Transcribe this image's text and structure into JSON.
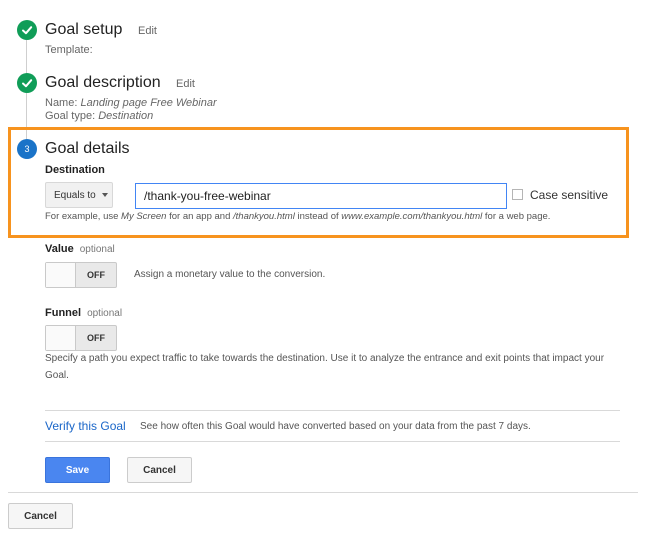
{
  "steps": [
    {
      "number": "1",
      "title": "Goal setup",
      "edit_label": "Edit",
      "details": {
        "template_label": "Template:"
      }
    },
    {
      "number": "2",
      "title": "Goal description",
      "edit_label": "Edit",
      "details": {
        "name_label": "Name:",
        "name_value": "Landing page Free Webinar",
        "type_label": "Goal type:",
        "type_value": "Destination"
      }
    },
    {
      "number": "3",
      "title": "Goal details"
    }
  ],
  "destination": {
    "label": "Destination",
    "match_type": "Equals to",
    "value": "/thank-you-free-webinar",
    "case_sensitive_label": "Case sensitive",
    "hint": {
      "p1": "For example, use ",
      "e1": "My Screen",
      "p2": " for an app and ",
      "e2": "/thankyou.html",
      "p3": " instead of ",
      "e3": "www.example.com/thankyou.html",
      "p4": " for a web page."
    }
  },
  "value_section": {
    "label": "Value",
    "optional": "optional",
    "toggle_state": "OFF",
    "description": "Assign a monetary value to the conversion."
  },
  "funnel_section": {
    "label": "Funnel",
    "optional": "optional",
    "toggle_state": "OFF",
    "description": "Specify a path you expect traffic to take towards the destination. Use it to analyze the entrance and exit points that impact your Goal."
  },
  "verify": {
    "link_label": "Verify this Goal",
    "description": "See how often this Goal would have converted based on your data from the past 7 days."
  },
  "buttons": {
    "save": "Save",
    "cancel": "Cancel",
    "cancel_outer": "Cancel"
  },
  "colors": {
    "highlight": "#f7931e",
    "done_step": "#109d58",
    "active_step": "#1a73c8",
    "primary_button": "#4a86f0",
    "link": "#1a66c8"
  }
}
